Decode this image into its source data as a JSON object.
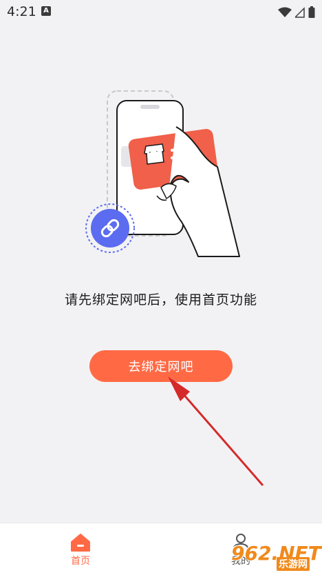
{
  "status_bar": {
    "time": "4:21",
    "app_icon": "A"
  },
  "main": {
    "prompt": "请先绑定网吧后，使用首页功能",
    "bind_button_label": "去绑定网吧"
  },
  "tab_bar": {
    "home_label": "首页",
    "mine_label": "我的"
  },
  "watermark": {
    "text": "962.NET",
    "sub": "乐游网"
  },
  "colors": {
    "accent": "#ff6a45",
    "card": "#f0604a",
    "link_badge": "#5b6cf0",
    "arrow": "#d42a2a",
    "background": "#f2f2f4"
  }
}
